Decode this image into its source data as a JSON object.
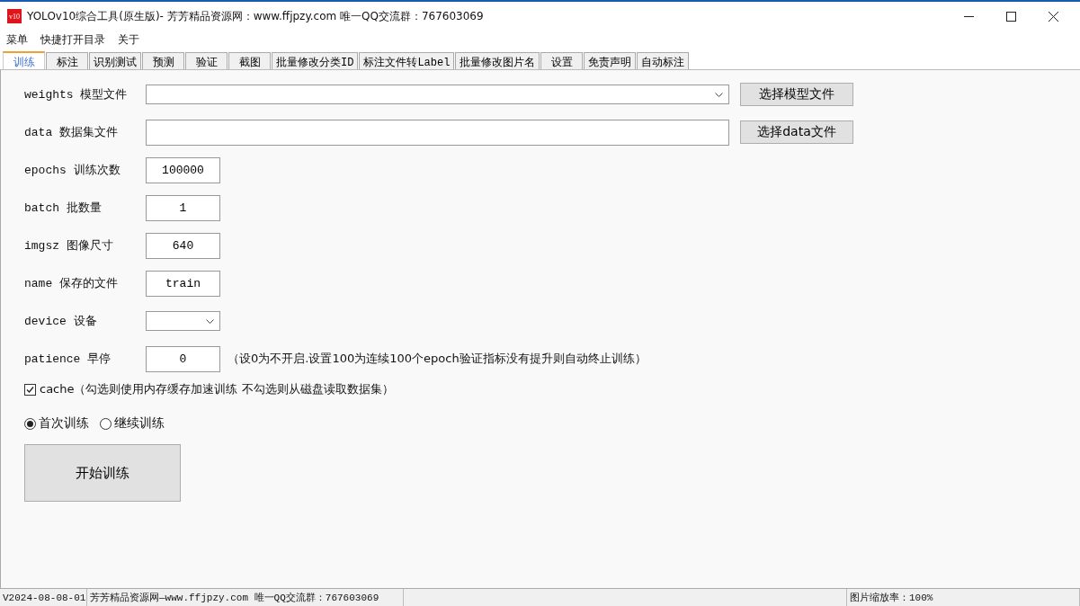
{
  "window": {
    "title": "YOLOv10综合工具(原生版)- 芳芳精品资源网：www.ffjpzy.com  唯一QQ交流群：767603069",
    "icon_text": "v10"
  },
  "menu": [
    "菜单",
    "快捷打开目录",
    "关于"
  ],
  "tabs": [
    {
      "label": "训练",
      "selected": true
    },
    {
      "label": "标注",
      "selected": false
    },
    {
      "label": "识别测试",
      "selected": false
    },
    {
      "label": "预测",
      "selected": false
    },
    {
      "label": "验证",
      "selected": false
    },
    {
      "label": "截图",
      "selected": false
    },
    {
      "label": "批量修改分类ID",
      "selected": false
    },
    {
      "label": "标注文件转Label",
      "selected": false
    },
    {
      "label": "批量修改图片名",
      "selected": false
    },
    {
      "label": "设置",
      "selected": false
    },
    {
      "label": "免责声明",
      "selected": false
    },
    {
      "label": "自动标注",
      "selected": false
    }
  ],
  "form": [
    {
      "kind": "combo",
      "label": "weights 模型文件",
      "wide": true,
      "button": "选择模型文件"
    },
    {
      "kind": "input",
      "label": "data 数据集文件",
      "wide": true,
      "button": "选择data文件"
    },
    {
      "kind": "input",
      "label": "epochs 训练次数",
      "value": "100000"
    },
    {
      "kind": "input",
      "label": "batch 批数量",
      "value": "1"
    },
    {
      "kind": "input",
      "label": "imgsz 图像尺寸",
      "value": "640"
    },
    {
      "kind": "input",
      "label": "name 保存的文件",
      "value": "train"
    },
    {
      "kind": "combo",
      "label": "device 设备"
    },
    {
      "kind": "input",
      "label": "patience 早停",
      "value": "0",
      "note": "（设0为不开启.设置100为连续100个epoch验证指标没有提升则自动终止训练）"
    }
  ],
  "cache": {
    "label": "cache（勾选则使用内存缓存加速训练 不勾选则从磁盘读取数据集）",
    "checked": true
  },
  "radios": [
    {
      "label": "首次训练",
      "selected": true
    },
    {
      "label": "继续训练",
      "selected": false
    }
  ],
  "start_button": "开始训练",
  "status_bar": [
    "V2024-08-08-01",
    "芳芳精品资源网—www.ffjpzy.com  唯一QQ交流群：767603069",
    "图片缩放率：100%"
  ]
}
